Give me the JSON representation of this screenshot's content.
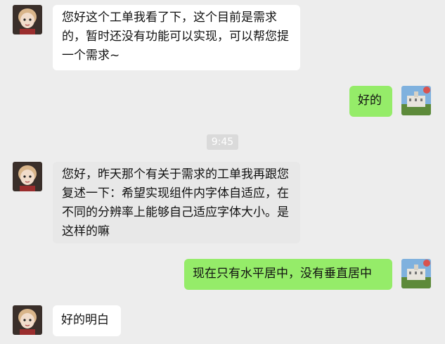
{
  "conversation": {
    "messages": [
      {
        "side": "left",
        "text": "您好这个工单我看了下，这个目前是需求的，暂时还没有功能可以实现，可以帮您提一个需求~"
      },
      {
        "side": "right",
        "text": "好的"
      },
      {
        "side": "left",
        "text": "您好，昨天那个有关于需求的工单我再跟您复述一下：希望实现组件内字体自适应，在不同的分辨率上能够自己适应字体大小。是这样的嘛"
      },
      {
        "side": "right",
        "text": "现在只有水平居中，没有垂直居中"
      },
      {
        "side": "left",
        "text": "好的明白"
      }
    ],
    "timestamp": "9:45"
  },
  "colors": {
    "background": "#ededed",
    "incoming_bubble": "#ffffff",
    "incoming_bubble_selected": "#e8e8e8",
    "outgoing_bubble": "#95ec69"
  },
  "icons": {
    "agent_avatar": "doll-avatar-icon",
    "user_avatar": "building-photo-avatar-icon"
  }
}
